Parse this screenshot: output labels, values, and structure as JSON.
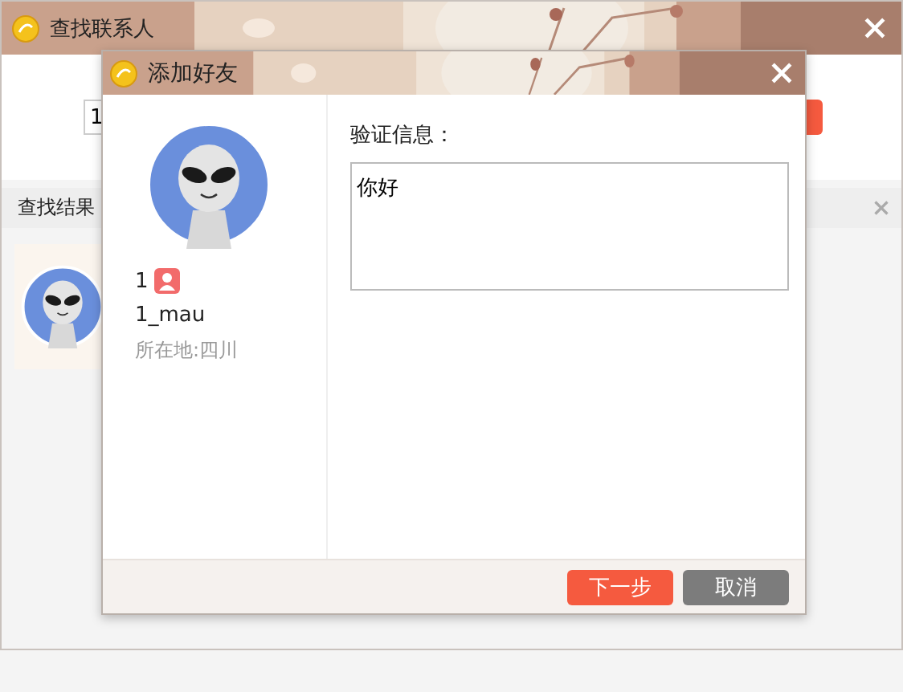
{
  "window": {
    "title": "查找联系人",
    "search": {
      "value": "1"
    },
    "results": {
      "title": "查找结果"
    }
  },
  "dialog": {
    "title": "添加好友",
    "profile": {
      "name": "1",
      "nickname": "1_mau",
      "location": "所在地:四川"
    },
    "verification": {
      "label": "验证信息：",
      "value": "你好"
    },
    "buttons": [
      {
        "label": "下一步",
        "kind": "primary"
      },
      {
        "label": "取消",
        "kind": "secondary"
      }
    ]
  }
}
